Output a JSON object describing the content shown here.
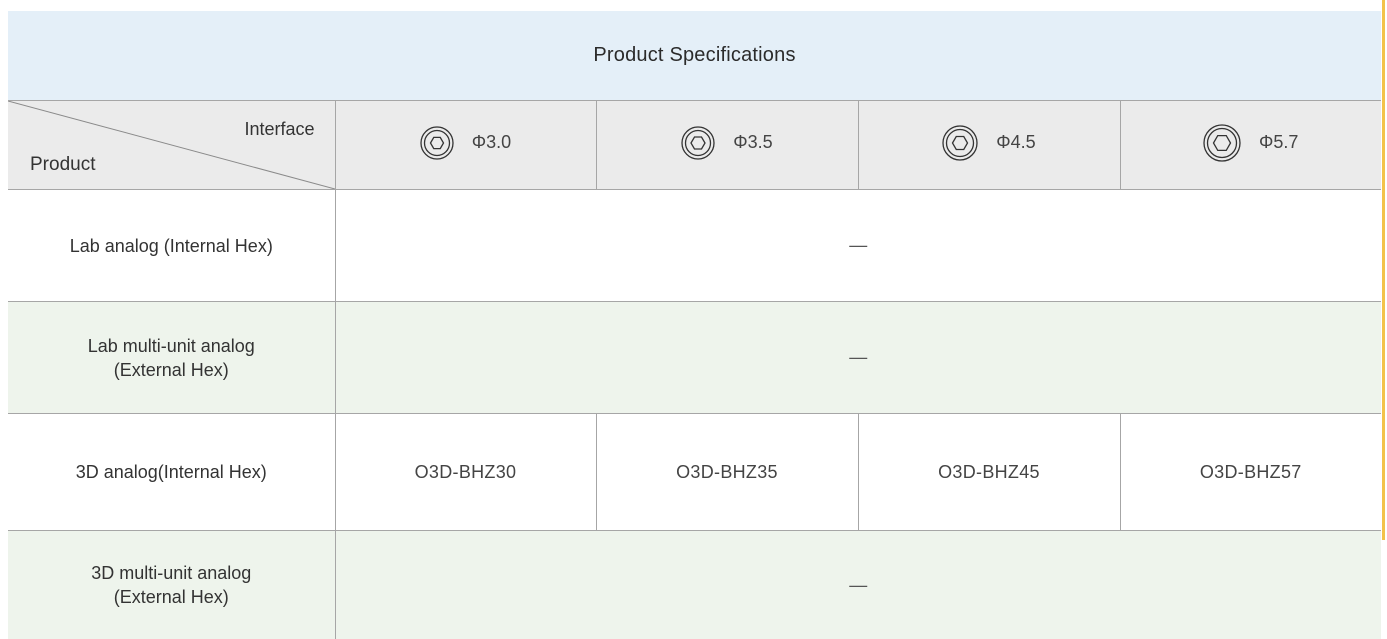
{
  "title": "Product Specifications",
  "corner": {
    "top_label": "Interface",
    "bottom_label": "Product"
  },
  "interfaces": [
    {
      "label": "Φ3.0",
      "icon": "hex-connector-icon"
    },
    {
      "label": "Φ3.5",
      "icon": "hex-connector-icon"
    },
    {
      "label": "Φ4.5",
      "icon": "hex-connector-icon"
    },
    {
      "label": "Φ5.7",
      "icon": "hex-connector-icon"
    }
  ],
  "rows": [
    {
      "product_line1": "Lab analog (Internal Hex)",
      "product_line2": "",
      "value": "—"
    },
    {
      "product_line1": "Lab multi-unit analog",
      "product_line2": "(External Hex)",
      "value": "—"
    },
    {
      "product_line1": "3D analog(Internal Hex)",
      "product_line2": "",
      "values": [
        "O3D-BHZ30",
        "O3D-BHZ35",
        "O3D-BHZ45",
        "O3D-BHZ57"
      ]
    },
    {
      "product_line1": "3D multi-unit analog",
      "product_line2": "(External Hex)",
      "value": "—"
    }
  ],
  "colors": {
    "title_bg": "#e4eff8",
    "header_bg": "#ebebeb",
    "alt_row_bg": "#eef4ec",
    "accent": "#f3c34a",
    "border": "#a6a6a6"
  }
}
